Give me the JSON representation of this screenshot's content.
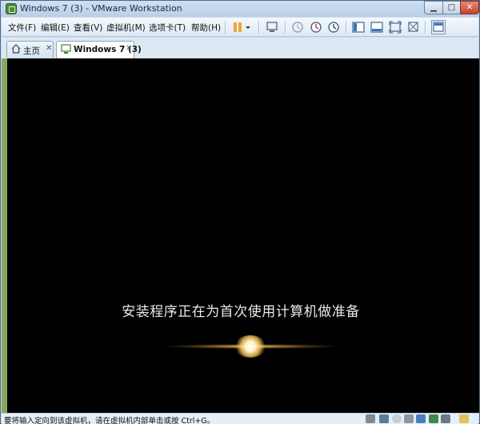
{
  "window": {
    "title": "Windows 7 (3) - VMware Workstation",
    "controls": {
      "minimize": "▁",
      "maximize": "□",
      "close": "✕"
    }
  },
  "menu": {
    "items": [
      {
        "label": "文件(F)"
      },
      {
        "label": "编辑(E)"
      },
      {
        "label": "查看(V)"
      },
      {
        "label": "虚拟机(M)"
      },
      {
        "label": "选项卡(T)"
      },
      {
        "label": "帮助(H)"
      }
    ]
  },
  "toolbar": {
    "icons": [
      "pause-icon",
      "dropdown-arrow-icon",
      "send-ctrl-alt-del-icon",
      "snapshot-icon",
      "revert-snapshot-icon",
      "snapshot-manager-icon",
      "sidebar-icon",
      "thumbnail-bar-icon",
      "fullscreen-icon",
      "unity-icon",
      "console-view-icon"
    ]
  },
  "tabs": [
    {
      "label": "主页",
      "icon": "home-icon",
      "close": "✕"
    },
    {
      "label": "Windows 7 (3)",
      "icon": "vm-icon",
      "close": "✕"
    }
  ],
  "vm": {
    "setup_message": "安装程序正在为首次使用计算机做准备"
  },
  "statusbar": {
    "message": "要将输入定向到该虚拟机，请在虚拟机内部单击或按 Ctrl+G。",
    "icons": [
      "hard-disk-icon",
      "network-icon",
      "cd-drive-icon",
      "usb-icon",
      "sound-icon",
      "printer-icon",
      "display-icon",
      "message-icon"
    ]
  },
  "colors": {
    "title_bar": "#c6dbf0",
    "accent_pause": "#e8a93a",
    "vm_background": "#000000",
    "setup_text": "#eaeaea"
  }
}
